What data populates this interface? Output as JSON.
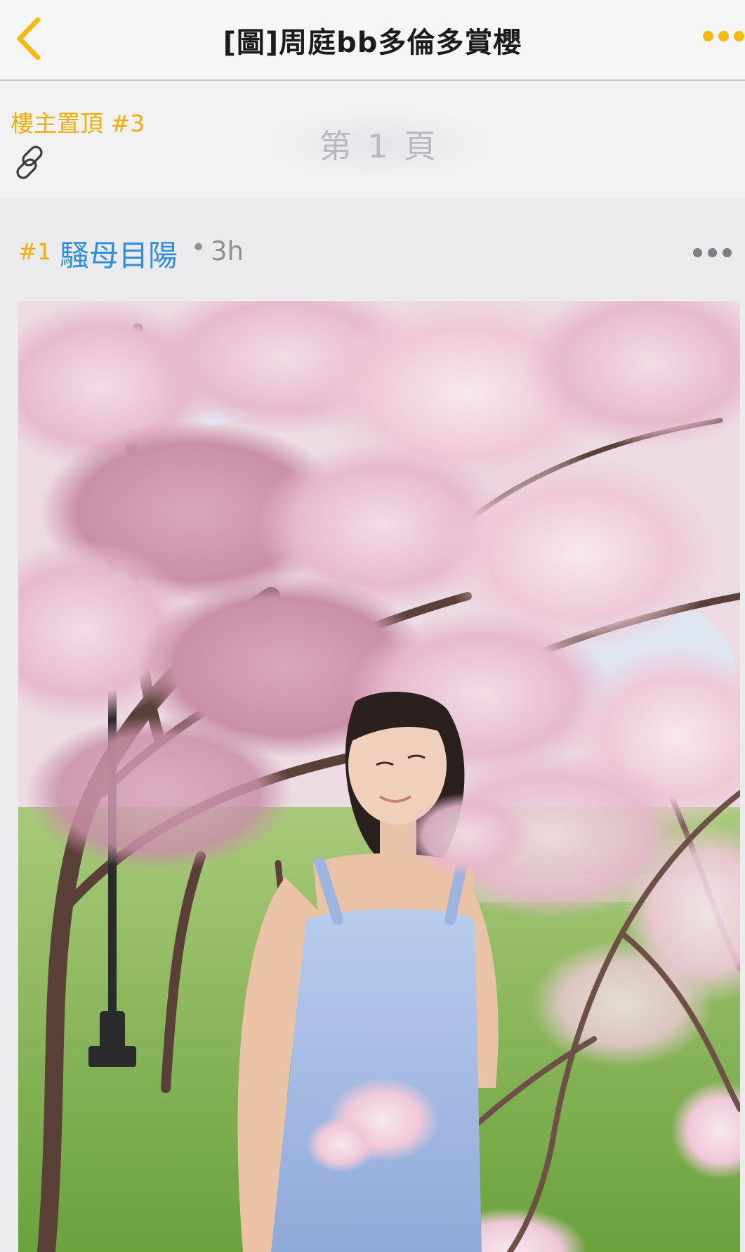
{
  "nav": {
    "title": "[圖]周庭bb多倫多賞櫻",
    "icons": {
      "back": "chevron-left-icon",
      "more": "ellipsis-icon"
    },
    "accent_color": "#f5b90f"
  },
  "pinned": {
    "label": "樓主置頂 #3",
    "link_icon": "link-icon",
    "page_indicator": "第 1 頁"
  },
  "post": {
    "floor": "#1",
    "author": "騷母目陽",
    "separator": "•",
    "time": "3h",
    "author_color": "#2f8fde",
    "photo_icon": "photo-image"
  }
}
